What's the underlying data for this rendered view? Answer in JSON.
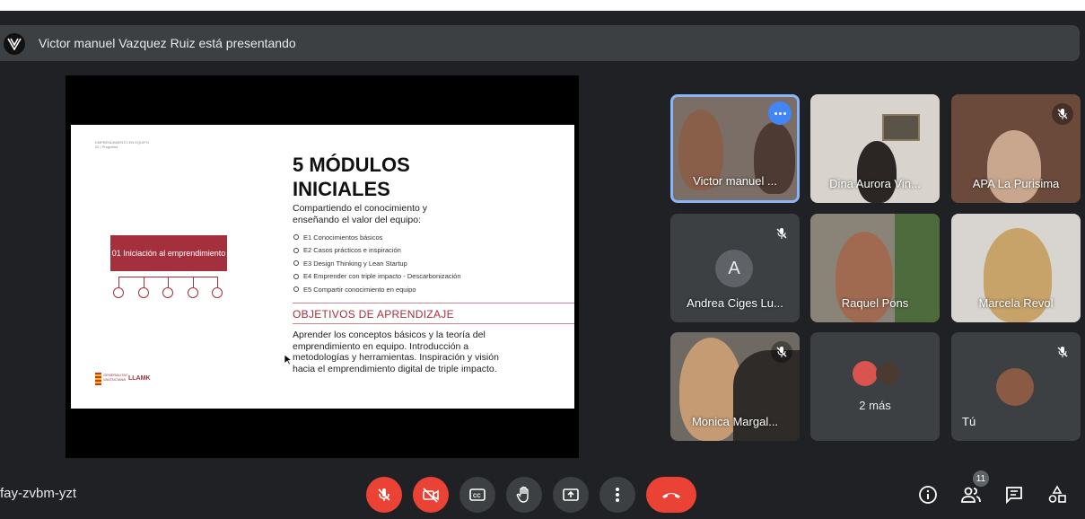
{
  "presentation_bar": {
    "presenter_text": "Victor manuel Vazquez Ruiz está presentando"
  },
  "slide": {
    "header_small_1": "EMPRENDIMIENTO EN EQUIPO",
    "header_small_2": "02 | Programa",
    "title": "5 MÓDULOS INICIALES",
    "subtitle": "Compartiendo el conocimiento y enseñando el valor del equipo:",
    "bullets": [
      "E1 Conocimientos básicos",
      "E2 Casos prácticos e inspiración",
      "E3 Design Thinking y Lean Startup",
      "E4 Emprender con triple impacto - Descarbonización",
      "E5 Compartir conocimiento en equipo"
    ],
    "box_label": "01 Iniciación al emprendimiento",
    "objectives_heading": "OBJETIVOS DE APRENDIZAJE",
    "objectives_body": "Aprender los conceptos básicos y la teoría del emprendimiento en equipo. Introducción a metodologías y herramientas. Inspiración y visión hacia el emprendimiento digital de triple impacto.",
    "logo_left": "GENERALITAT VALENCIANA",
    "logo_right": "LLAMK"
  },
  "participants": [
    {
      "name": "Victor manuel ...",
      "muted": false,
      "active": true
    },
    {
      "name": "Dina Aurora Vin...",
      "muted": false
    },
    {
      "name": "APA La Purisima",
      "muted": true
    },
    {
      "name": "Andrea Ciges Lu...",
      "muted": true,
      "initial": "A"
    },
    {
      "name": "Raquel Pons",
      "muted": false
    },
    {
      "name": "Marcela Revol",
      "muted": false
    },
    {
      "name": "Monica Margal...",
      "muted": true
    },
    {
      "name": "2 más",
      "muted": false
    },
    {
      "name": "Tú",
      "muted": true
    }
  ],
  "meeting": {
    "code": "fay-zvbm-yzt",
    "people_count": "11"
  },
  "colors": {
    "bg": "#202124",
    "tile": "#3c4043",
    "red": "#ea4335",
    "accent": "#a4303d",
    "active_border": "#8ab4f8"
  },
  "icons": [
    "mic-off-icon",
    "camera-off-icon",
    "captions-icon",
    "raise-hand-icon",
    "present-icon",
    "more-options-icon",
    "end-call-icon",
    "info-icon",
    "people-icon",
    "chat-icon",
    "activities-icon"
  ]
}
